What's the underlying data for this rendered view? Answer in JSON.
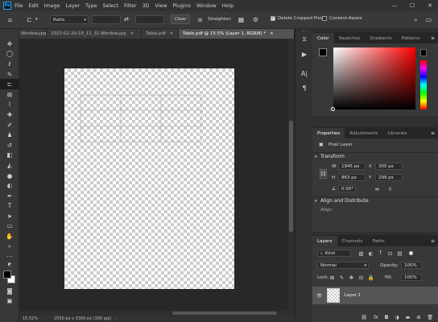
{
  "app": {
    "logo": "Ps"
  },
  "menu": [
    "File",
    "Edit",
    "Image",
    "Layer",
    "Type",
    "Select",
    "Filter",
    "3D",
    "View",
    "Plugins",
    "Window",
    "Help"
  ],
  "window_controls": [
    "—",
    "☐",
    "✕"
  ],
  "options": {
    "ratio_label": "Ratio",
    "swap_icon": "⇄",
    "clear_label": "Clear",
    "straighten_label": "Straighten",
    "delete_cropped_label": "Delete Cropped Pixels",
    "delete_cropped_checked": true,
    "content_aware_label": "Content-Aware",
    "content_aware_checked": false
  },
  "tabs": [
    {
      "label": "Window.jpg",
      "active": false
    },
    {
      "label": "2023-02-20-10_11_31-Window.jpg",
      "active": false
    },
    {
      "label": "Table.pdf",
      "active": false
    },
    {
      "label": "Table.pdf @ 15.5% (Layer 1, RGB/8) *",
      "active": true
    }
  ],
  "status": {
    "zoom": "15.52%",
    "doc_info": "2550 px x 3300 px (300 ppi)"
  },
  "panels": {
    "color": {
      "tabs": [
        "Color",
        "Swatches",
        "Gradients",
        "Patterns"
      ]
    },
    "properties": {
      "tabs": [
        "Properties",
        "Adjustments",
        "Libraries"
      ],
      "kind": "Pixel Layer",
      "transform_title": "Transform",
      "w_label": "W",
      "w_value": "1945 px",
      "h_label": "H",
      "h_value": "863 px",
      "x_label": "X",
      "x_value": "300 px",
      "y_label": "Y",
      "y_value": "299 px",
      "angle": "0.00°",
      "align_title": "Align and Distribute",
      "align_label": "Align:"
    },
    "layers": {
      "tabs": [
        "Layers",
        "Channels",
        "Paths"
      ],
      "kind_label": "Kind",
      "blend_mode": "Normal",
      "opacity_label": "Opacity:",
      "opacity": "100%",
      "lock_label": "Lock:",
      "fill_label": "Fill:",
      "fill": "100%",
      "layer_name": "Layer 1"
    }
  },
  "colors": {
    "accent": "#31a8ff",
    "fg": "#000000",
    "bg": "#ffffff"
  }
}
